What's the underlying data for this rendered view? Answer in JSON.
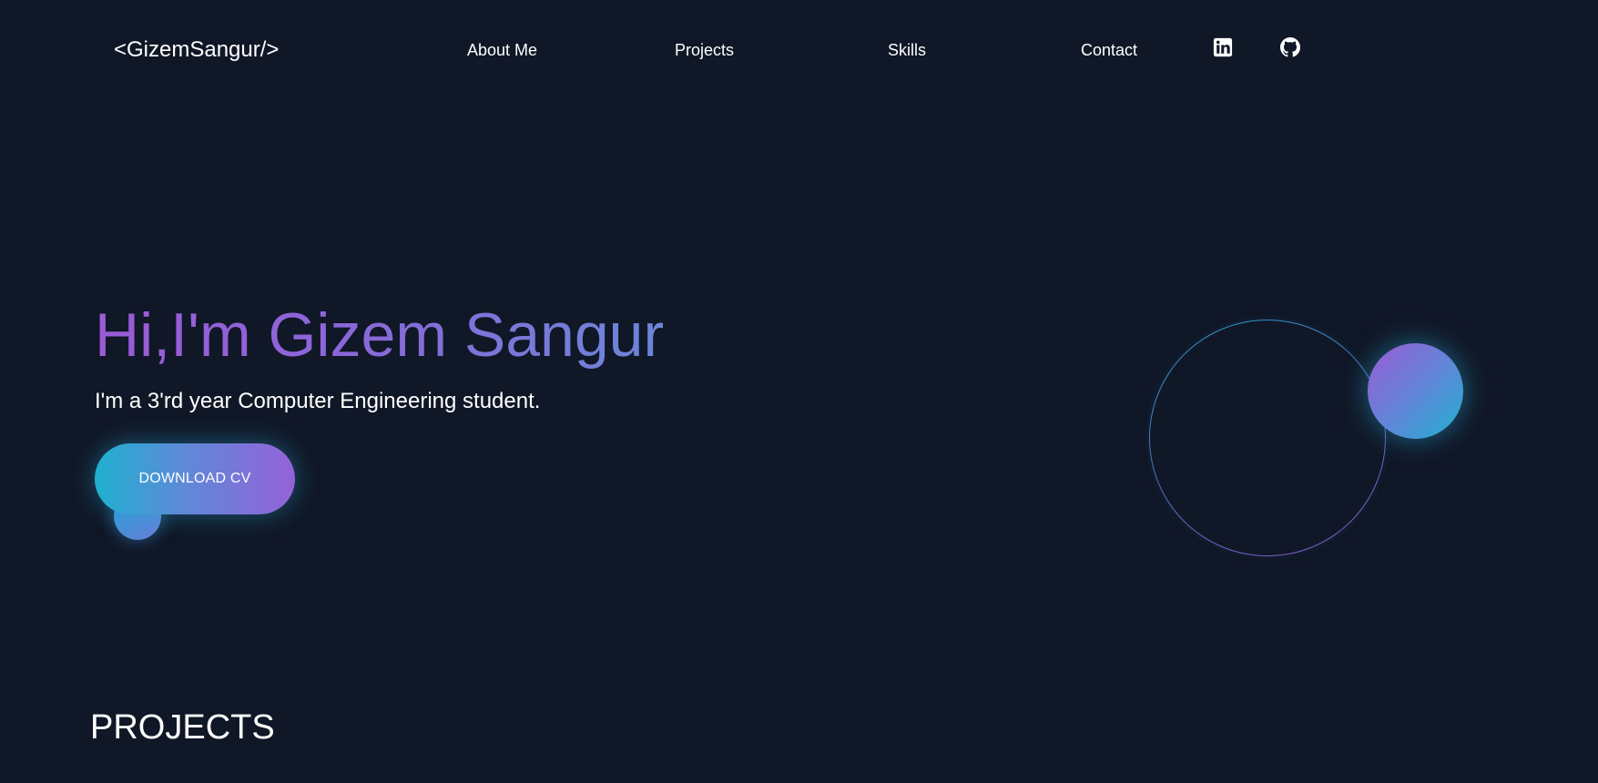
{
  "nav": {
    "logo": "<GizemSangur/>",
    "links": [
      "About Me",
      "Projects",
      "Skills",
      "Contact"
    ],
    "social": [
      {
        "icon": "linkedin-icon"
      },
      {
        "icon": "github-icon"
      }
    ]
  },
  "hero": {
    "title": "Hi,I'm Gizem Sangur",
    "subtitle": "I'm a 3'rd year Computer Engineering student.",
    "cv_button": "DOWNLOAD CV"
  },
  "sections": {
    "projects_title": "PROJECTS"
  },
  "colors": {
    "background": "#101726",
    "accent_purple": "#9b5bd6",
    "accent_cyan": "#1fb0d0",
    "text": "#ffffff"
  }
}
